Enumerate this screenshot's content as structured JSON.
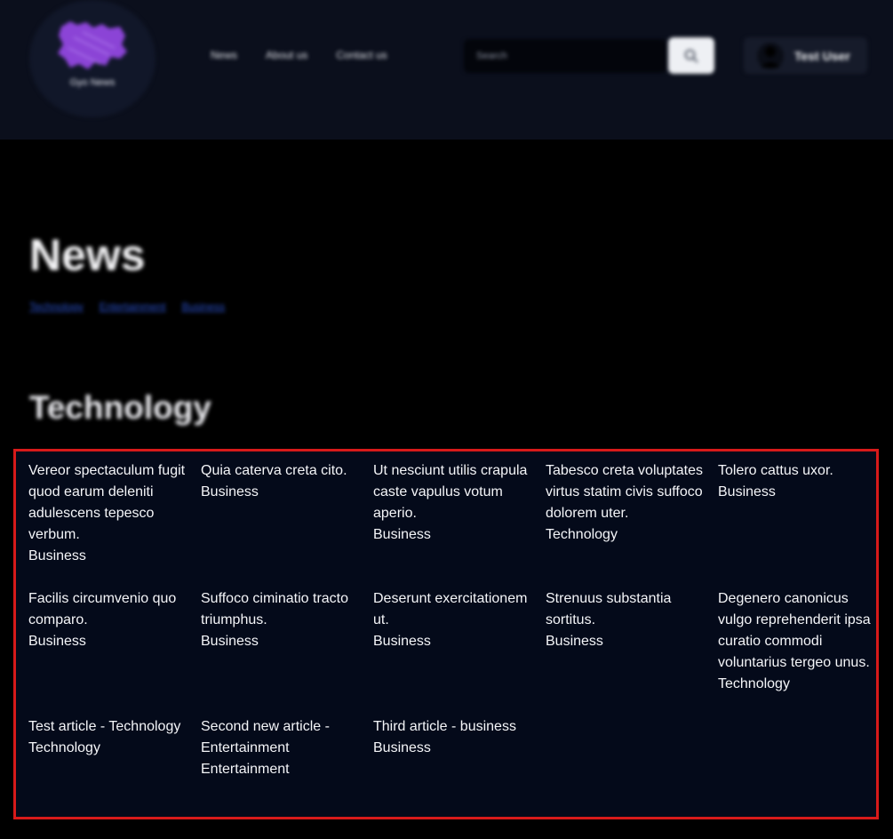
{
  "header": {
    "logo_text": "Gyo News",
    "nav": [
      "News",
      "About us",
      "Contact us"
    ],
    "search_placeholder": "Search",
    "user_name": "Test User"
  },
  "page": {
    "title": "News",
    "categories": [
      "Technology",
      "Entertainment",
      "Business"
    ],
    "section_title": "Technology"
  },
  "articles": [
    {
      "title": "Vereor spectaculum fugit quod earum deleniti adulescens tepesco verbum.",
      "category": "Business"
    },
    {
      "title": "Quia caterva creta cito.",
      "category": "Business"
    },
    {
      "title": "Ut nesciunt utilis crapula caste vapulus votum aperio.",
      "category": "Business"
    },
    {
      "title": "Tabesco creta voluptates virtus statim civis suffoco dolorem uter.",
      "category": "Technology"
    },
    {
      "title": "Tolero cattus uxor.",
      "category": "Business"
    },
    {
      "title": "Facilis circumvenio quo comparo.",
      "category": "Business"
    },
    {
      "title": "Suffoco ciminatio tracto triumphus.",
      "category": "Business"
    },
    {
      "title": "Deserunt exercitationem ut.",
      "category": "Business"
    },
    {
      "title": "Strenuus substantia sortitus.",
      "category": "Business"
    },
    {
      "title": "Degenero canonicus vulgo reprehenderit ipsa curatio commodi voluntarius tergeo unus.",
      "category": "Technology"
    },
    {
      "title": "Test article - Technology",
      "category": "Technology"
    },
    {
      "title": "Second new article - Entertainment",
      "category": "Entertainment"
    },
    {
      "title": "Third article - business",
      "category": "Business"
    }
  ],
  "colors": {
    "header_bg": "#0b0f1c",
    "page_bg": "#000000",
    "articles_bg": "#040a1a",
    "logo_purple": "#8b44d6",
    "link_blue": "#2a50c9",
    "highlight_red": "#d71a1a"
  },
  "icons": {
    "search": "search-icon",
    "avatar": "user-avatar-icon"
  }
}
